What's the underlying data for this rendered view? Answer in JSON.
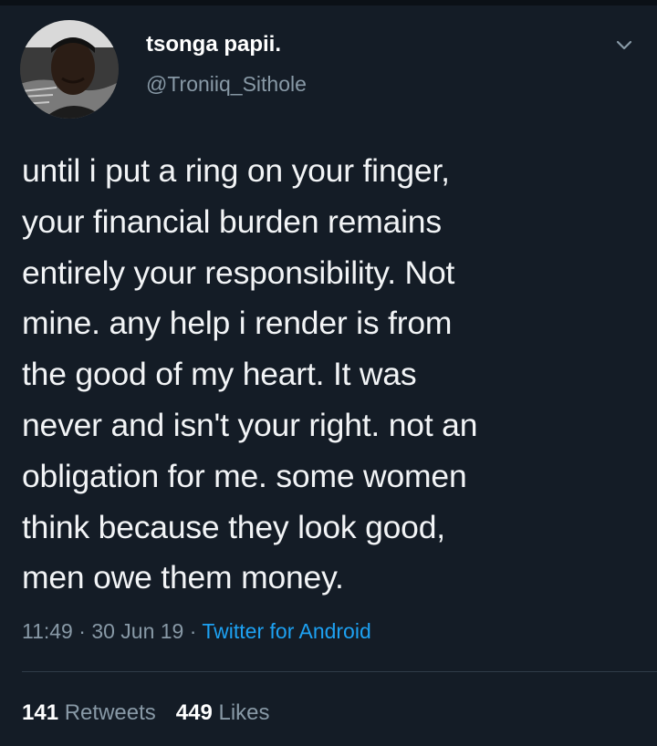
{
  "user": {
    "display_name": "tsonga papii.",
    "handle": "@Troniiq_Sithole"
  },
  "tweet": {
    "text_lines": [
      "until i put a ring on your finger,",
      "your financial burden remains",
      "entirely your responsibility. Not",
      "mine. any help i render is from",
      "the good of my heart. It was",
      "never and isn't your right. not an",
      "obligation for me. some women",
      "think because they look good,",
      "men owe them money."
    ],
    "time": "11:49",
    "date": "30 Jun 19",
    "separator": "·",
    "source": "Twitter for Android"
  },
  "stats": {
    "retweets_count": "141",
    "retweets_label": "Retweets",
    "likes_count": "449",
    "likes_label": "Likes"
  },
  "icons": {
    "menu": "chevron-down-icon",
    "avatar": "avatar"
  },
  "colors": {
    "background": "#141c26",
    "text": "#ffffff",
    "muted": "#8899a6",
    "link": "#1da1f2"
  }
}
